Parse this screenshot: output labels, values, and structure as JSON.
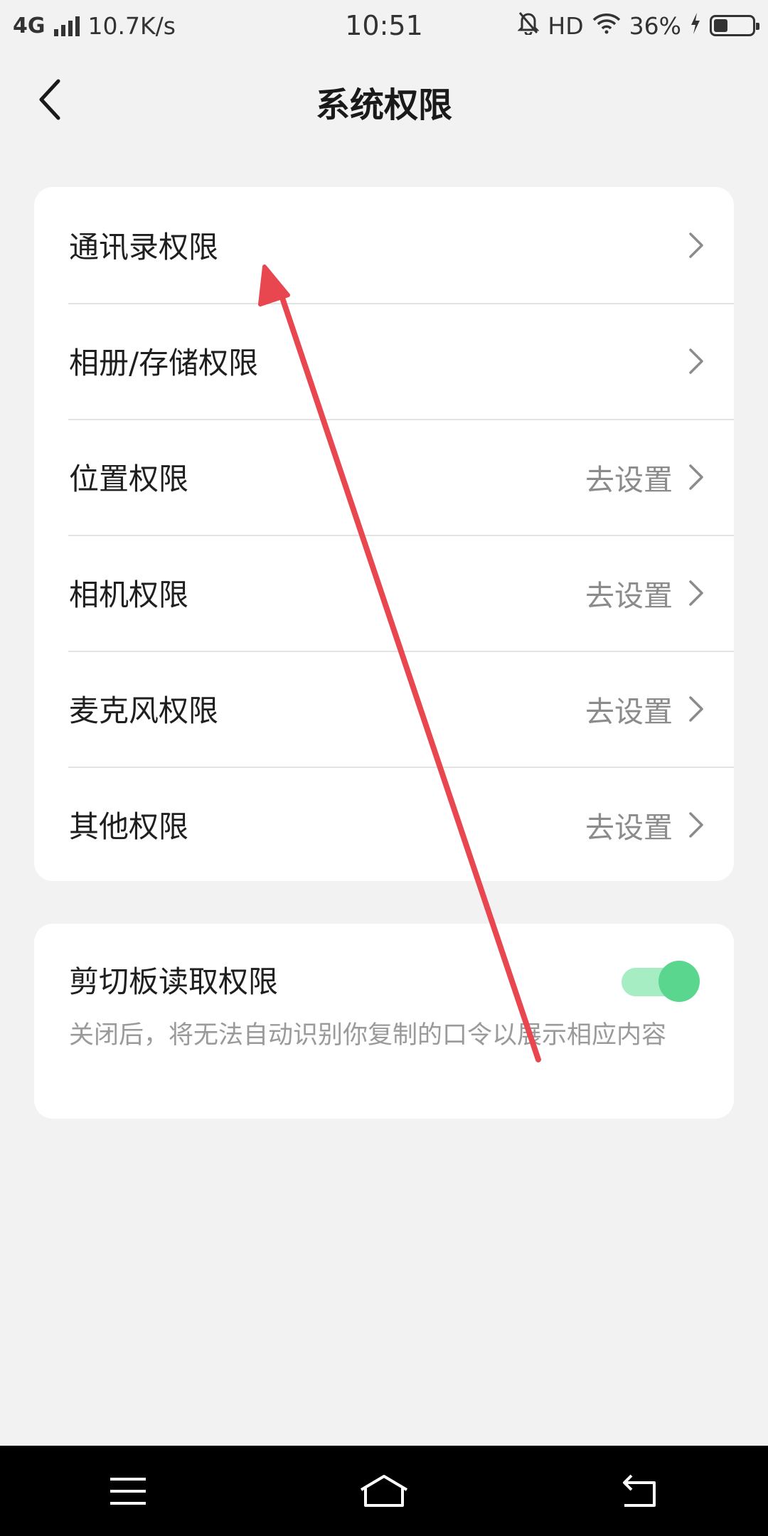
{
  "status_bar": {
    "network": "4G",
    "speed": "10.7K/s",
    "time": "10:51",
    "hd": "HD",
    "battery_percent": "36%",
    "battery_level": 0.36
  },
  "header": {
    "title": "系统权限",
    "back_icon": "chevron-left-icon"
  },
  "permissions": [
    {
      "label": "通讯录权限",
      "action": ""
    },
    {
      "label": "相册/存储权限",
      "action": ""
    },
    {
      "label": "位置权限",
      "action": "去设置"
    },
    {
      "label": "相机权限",
      "action": "去设置"
    },
    {
      "label": "麦克风权限",
      "action": "去设置"
    },
    {
      "label": "其他权限",
      "action": "去设置"
    }
  ],
  "clipboard": {
    "title": "剪切板读取权限",
    "description": "关闭后，将无法自动识别你复制的口令以展示相应内容",
    "enabled": true
  },
  "colors": {
    "background": "#f2f2f2",
    "card": "#ffffff",
    "toggle_on": "#5ad68f",
    "annotation_arrow": "#e8474f"
  },
  "nav_bar": {
    "menu_icon": "menu-icon",
    "home_icon": "home-icon",
    "back_icon": "back-arrow-icon"
  }
}
